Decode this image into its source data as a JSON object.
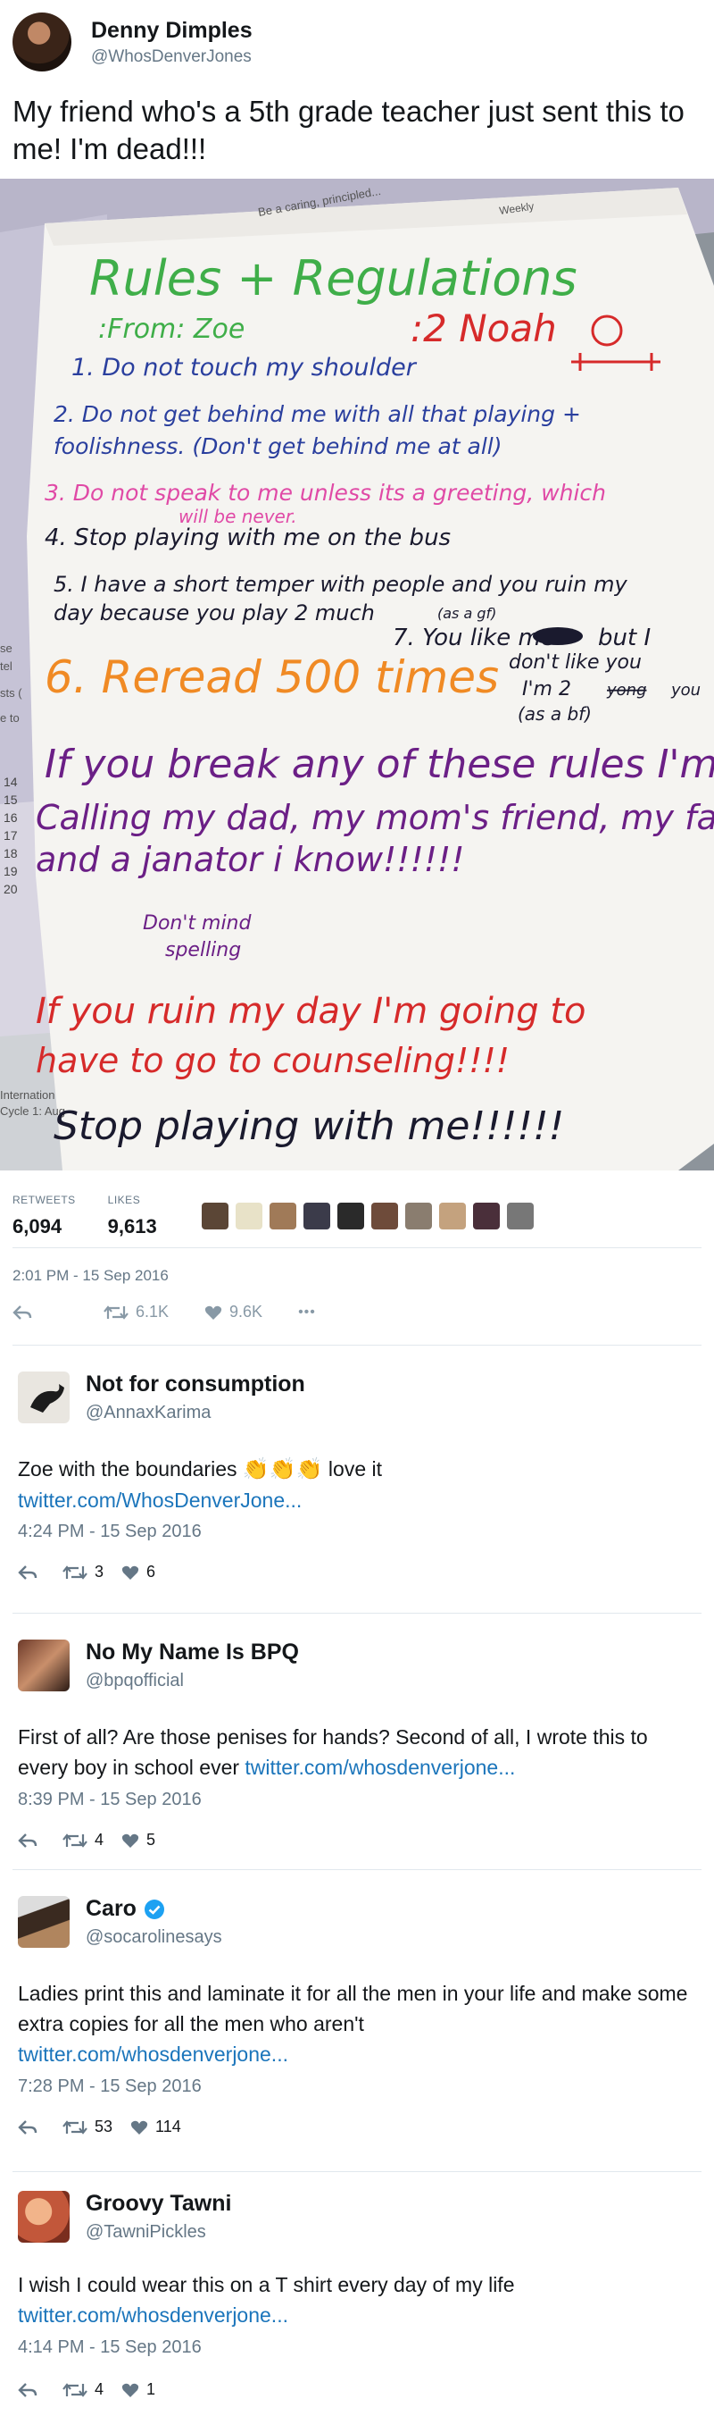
{
  "tweet": {
    "author_name": "Denny Dimples",
    "author_handle": "@WhosDenverJones",
    "text": "My friend who's a 5th grade teacher just sent this to me! I'm dead!!!",
    "note": {
      "title": "Rules + Regulations",
      "from": ":From: Zoe",
      "to": ":2 Noah",
      "rule1": "1. Do not touch my shoulder",
      "rule2a": "2. Do not get behind me with all that playing +",
      "rule2b": "foolishness. (Don't get behind me at all)",
      "rule3a": "3. Do not speak to me unless its a greeting, which",
      "rule3b": "will be never.",
      "rule4": "4. Stop playing with me on the bus",
      "rule5a": "5. I have a short temper with people and you ruin my",
      "rule5b": "day because you play 2 much",
      "rule7": "7. You like me",
      "rule7b": "but I",
      "asgf": "(as a gf)",
      "rule6": "6. Reread 500 times",
      "dontlike": "don't like you",
      "im2": "I'm 2",
      "yong": "yong",
      "youfor": "you",
      "asbf": "(as a bf)",
      "break1": "If you break any of these rules I'm",
      "break2": "Calling my dad, my mom's friend, my fake mo",
      "break3": "and a janator i know!!!!!!",
      "dontmind": "Don't mind",
      "spelling": "spelling",
      "ruin1": "If you ruin my day I'm going to",
      "ruin2": "have to go to counseling!!!!",
      "stop": "Stop playing with me!!!!!!",
      "paper_top": "Be a caring, principled...",
      "weekly": "Weekly",
      "row_numbers": [
        "14",
        "15",
        "16",
        "17",
        "18",
        "19",
        "20"
      ],
      "margin_words": [
        "se",
        "tel",
        "sts (",
        "e to"
      ],
      "intl": "Internation",
      "cycle": "Cycle 1: Aug"
    },
    "stats": {
      "retweets_label": "RETWEETS",
      "retweets": "6,094",
      "likes_label": "LIKES",
      "likes": "9,613"
    },
    "timestamp": "2:01 PM - 15 Sep 2016",
    "actions": {
      "retweet_count": "6.1K",
      "like_count": "9.6K",
      "more": "•••"
    }
  },
  "replies": [
    {
      "name": "Not for consumption",
      "handle": "@AnnaxKarima",
      "text_before": "Zoe with the boundaries ",
      "emoji": "👏👏👏",
      "text_after": " love it",
      "link": "twitter.com/WhosDenverJone...",
      "time": "4:24 PM - 15 Sep 2016",
      "retweets": "3",
      "likes": "6"
    },
    {
      "name": "No My Name Is BPQ",
      "handle": "@bpqofficial",
      "text": "First of all? Are those penises for hands? Second of all, I wrote this to every boy in school ever ",
      "link": "twitter.com/whosdenverjone...",
      "time": "8:39 PM - 15 Sep 2016",
      "retweets": "4",
      "likes": "5"
    },
    {
      "name": "Caro",
      "handle": "@socarolinesays",
      "text": "Ladies print this and laminate it for all the men in your life and make some extra copies for all the men who aren't",
      "link": "twitter.com/whosdenverjone...",
      "time": "7:28 PM - 15 Sep 2016",
      "retweets": "53",
      "likes": "114"
    },
    {
      "name": "Groovy Tawni",
      "handle": "@TawniPickles",
      "text": "I wish I could wear this on a T shirt every day of my life",
      "link": "twitter.com/whosdenverjone...",
      "time": "4:14 PM - 15 Sep 2016",
      "retweets": "4",
      "likes": "1"
    }
  ],
  "colors": {
    "link": "#1b75bb",
    "muted": "#657786",
    "verified": "#1da1f2",
    "marker_green": "#3fae49",
    "marker_blue": "#2a3f9e",
    "marker_pink": "#e04aa6",
    "marker_orange": "#f08a24",
    "marker_purple": "#6b1f86",
    "marker_red": "#d62a2a"
  },
  "icons": [
    "reply-icon",
    "retweet-icon",
    "heart-icon",
    "more-icon",
    "verified-icon"
  ]
}
